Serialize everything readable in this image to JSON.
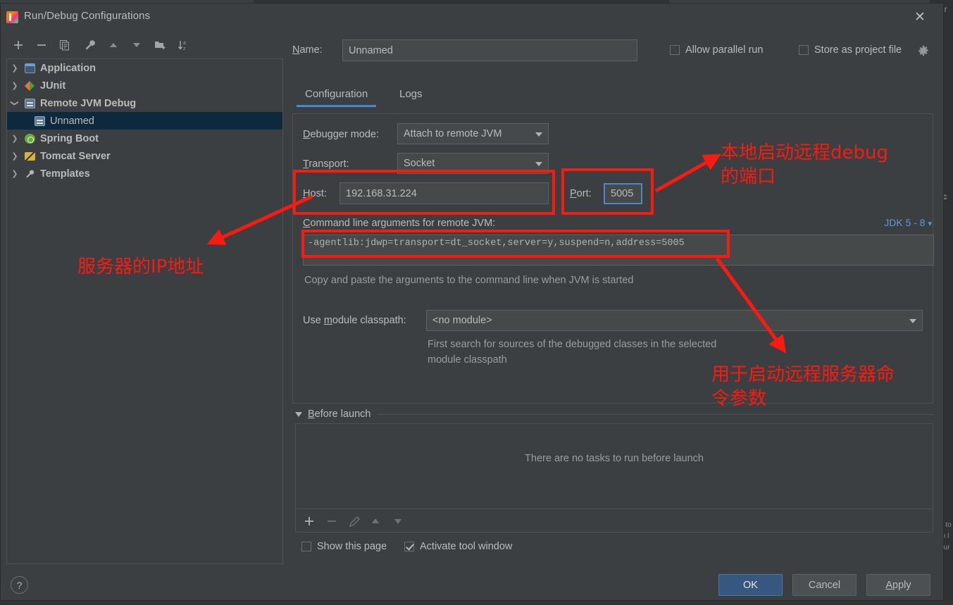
{
  "window": {
    "title": "Run/Debug Configurations",
    "app_icon": "intellij-idea-icon",
    "close_icon": "close-icon"
  },
  "toolbar": {
    "icons": [
      {
        "name": "add-icon",
        "glyph": "+"
      },
      {
        "name": "remove-icon",
        "glyph": "−"
      },
      {
        "name": "copy-icon",
        "glyph": "copy"
      },
      {
        "name": "edit-templates-icon",
        "glyph": "wrench"
      },
      {
        "name": "move-up-icon",
        "glyph": "up"
      },
      {
        "name": "move-down-icon",
        "glyph": "down"
      },
      {
        "name": "new-folder-icon",
        "glyph": "folder-plus"
      },
      {
        "name": "sort-alphabetically-icon",
        "glyph": "sort-az"
      }
    ]
  },
  "tree": {
    "items": [
      {
        "label": "Application",
        "icon": "application-icon",
        "expanded": false,
        "child": false,
        "selected": false
      },
      {
        "label": "JUnit",
        "icon": "junit-icon",
        "expanded": false,
        "child": false,
        "selected": false
      },
      {
        "label": "Remote JVM Debug",
        "icon": "remote-jvm-icon",
        "expanded": true,
        "child": false,
        "selected": false
      },
      {
        "label": "Unnamed",
        "icon": "remote-jvm-icon",
        "expanded": null,
        "child": true,
        "selected": true
      },
      {
        "label": "Spring Boot",
        "icon": "spring-boot-icon",
        "expanded": false,
        "child": false,
        "selected": false
      },
      {
        "label": "Tomcat Server",
        "icon": "tomcat-icon",
        "expanded": false,
        "child": false,
        "selected": false
      },
      {
        "label": "Templates",
        "icon": "templates-icon",
        "expanded": false,
        "child": false,
        "selected": false
      }
    ]
  },
  "form": {
    "name_label": "Name:",
    "name_value": "Unnamed",
    "allow_parallel_run": {
      "label": "Allow parallel run",
      "checked": false
    },
    "store_as_project_file": {
      "label": "Store as project file",
      "checked": false
    },
    "gear_icon": "gear-icon",
    "tabs": [
      {
        "label": "Configuration",
        "active": true
      },
      {
        "label": "Logs",
        "active": false
      }
    ],
    "debugger_mode_label": "Debugger mode:",
    "debugger_mode_value": "Attach to remote JVM",
    "transport_label": "Transport:",
    "transport_value": "Socket",
    "host_label": "Host:",
    "host_value": "192.168.31.224",
    "port_label": "Port:",
    "port_value": "5005",
    "cmd_args_label": "Command line arguments for remote JVM:",
    "cmd_args_value": "-agentlib:jdwp=transport=dt_socket,server=y,suspend=n,address=5005",
    "jdk_selector": "JDK 5 - 8",
    "copy_paste_hint": "Copy and paste the arguments to the command line when JVM is started",
    "module_classpath_label": "Use module classpath:",
    "module_classpath_value": "<no module>",
    "module_hint_line1": "First search for sources of the debugged classes in the selected",
    "module_hint_line2": "module classpath"
  },
  "before_launch": {
    "title": "Before launch",
    "empty_text": "There are no tasks to run before launch",
    "toolbar_icons": [
      {
        "name": "add-task-icon",
        "glyph": "+"
      },
      {
        "name": "remove-task-icon",
        "glyph": "−"
      },
      {
        "name": "edit-task-icon",
        "glyph": "pencil"
      },
      {
        "name": "move-task-up-icon",
        "glyph": "up"
      },
      {
        "name": "move-task-down-icon",
        "glyph": "down"
      }
    ],
    "show_this_page": {
      "label": "Show this page",
      "checked": false
    },
    "activate_tool_window": {
      "label": "Activate tool window",
      "checked": true
    }
  },
  "footer": {
    "help_label": "?",
    "ok_label": "OK",
    "cancel_label": "Cancel",
    "apply_label": "Apply"
  },
  "annotations": {
    "color": "#fb1a10",
    "note_ip": "服务器的IP地址",
    "note_port_line1": "本地启动远程debug",
    "note_port_line2": "的端口",
    "note_args_line1": "用于启动远程服务器命",
    "note_args_line2": "令参数"
  },
  "background": {
    "right_text_1": "er",
    "right_text_2": "c",
    "right_text_3": "e to",
    "right_text_4": "to l",
    "right_text_5": "our"
  },
  "colors": {
    "dialog_bg": "#3c3f41",
    "panel_border": "#4e5254",
    "field_bg": "#45494a",
    "text": "#bbbbbb",
    "muted_text": "#9a9c9d",
    "accent_blue": "#4a88c7",
    "link_blue": "#5b9bd5",
    "selection_bg": "#0d293e",
    "primary_button": "#365880",
    "annotation_red": "#fb1a10"
  }
}
